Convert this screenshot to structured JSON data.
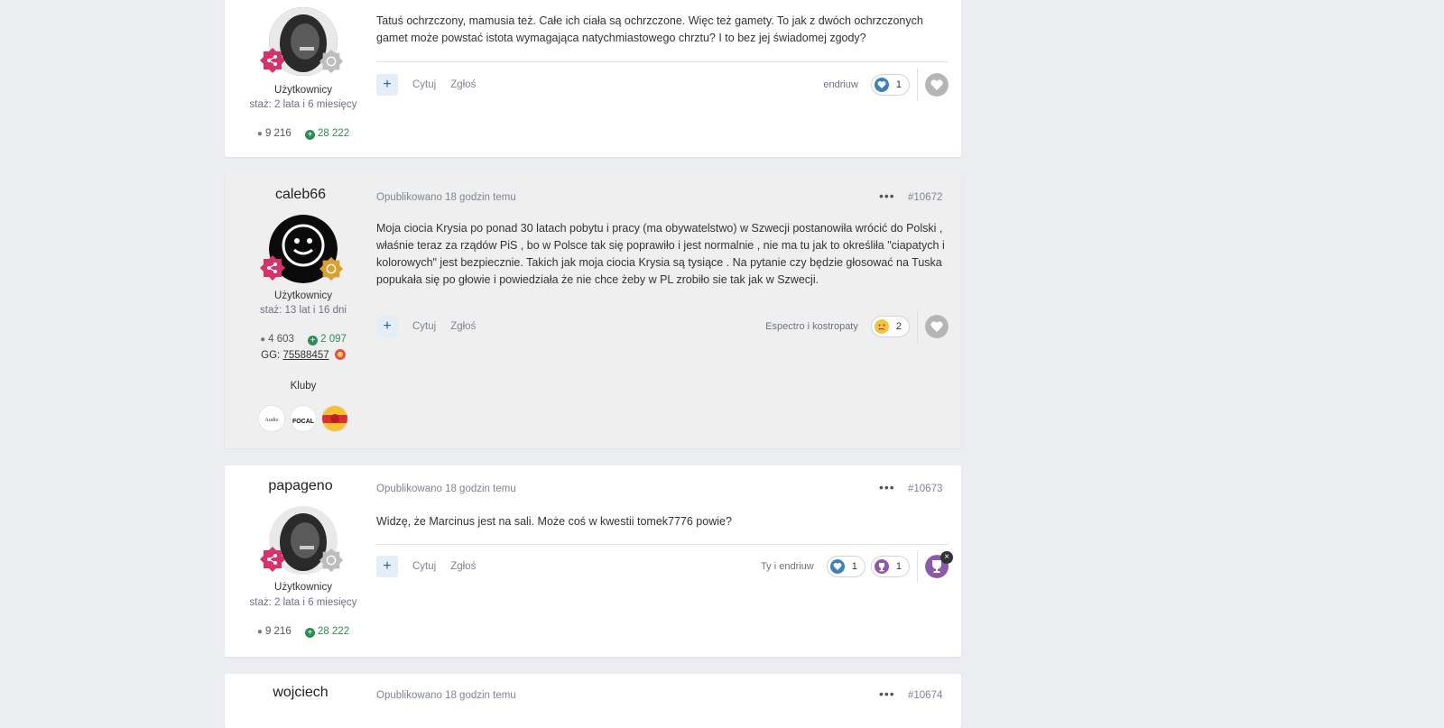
{
  "posts": [
    {
      "id": "post-prev",
      "author_name": "",
      "group": "Użytkownicy",
      "since": "staż: 2 lata i 6 miesięcy",
      "posts_count": "9 216",
      "reputation": "28 222",
      "content": "Tatuś ochrzczony, mamusia też. Całe ich ciała są ochrzczone. Więc też gamety. To jak z dwóch ochrzczonych gamet może powstać istota wymagająca natychmiastowego chrztu? I to bez jej świadomej zgody?",
      "quote_label": "Cytuj",
      "report_label": "Zgłoś",
      "reactors": "endriuw",
      "reactions": [
        {
          "icon": "like-icon",
          "count": "1"
        }
      ]
    },
    {
      "id": "post-10672",
      "author_name": "caleb66",
      "published": "Opublikowano 18 godzin temu",
      "post_number": "#10672",
      "group": "Użytkownicy",
      "since": "staż: 13 lat i 16 dni",
      "posts_count": "4 603",
      "reputation": "2 097",
      "gg_label": "GG:",
      "gg_number": "75588457",
      "clubs_label": "Kluby",
      "content": "Moja ciocia Krysia po ponad 30 latach pobytu i pracy (ma obywatelstwo) w Szwecji postanowiła wrócić do Polski , właśnie teraz za rządów PiS , bo w Polsce tak się poprawiło i jest normalnie , nie ma tu jak to określiła \"ciapatych i kolorowych\" jest bezpiecznie. Takich jak moja ciocia Krysia są tysiące . Na pytanie czy będzie głosować na Tuska popukała się po głowie i powiedziała że nie chce żeby w PL zrobiło sie tak jak w Szwecji.",
      "quote_label": "Cytuj",
      "report_label": "Zgłoś",
      "reactors": "Espectro i kostropaty",
      "reactions": [
        {
          "icon": "confused-face-icon",
          "count": "2"
        }
      ]
    },
    {
      "id": "post-10673",
      "author_name": "papageno",
      "published": "Opublikowano 18 godzin temu",
      "post_number": "#10673",
      "group": "Użytkownicy",
      "since": "staż: 2 lata i 6 miesięcy",
      "posts_count": "9 216",
      "reputation": "28 222",
      "content": "Widzę, że Marcinus jest na sali. Może coś w kwestii tomek7776 powie?",
      "quote_label": "Cytuj",
      "report_label": "Zgłoś",
      "reactors": "Ty i endriuw",
      "reactions": [
        {
          "icon": "like-icon",
          "count": "1"
        },
        {
          "icon": "trophy-icon",
          "count": "1"
        }
      ]
    },
    {
      "id": "post-10674",
      "author_name": "wojciech",
      "published": "Opublikowano 18 godzin temu",
      "post_number": "#10674"
    }
  ],
  "icons": {
    "plus": "+",
    "dots": "•••",
    "close": "×"
  },
  "colors": {
    "accent": "#285f9b",
    "rank_pink": "#d6336c",
    "reputation_green": "#2e8b57",
    "highlight_bg": "#efefef"
  }
}
